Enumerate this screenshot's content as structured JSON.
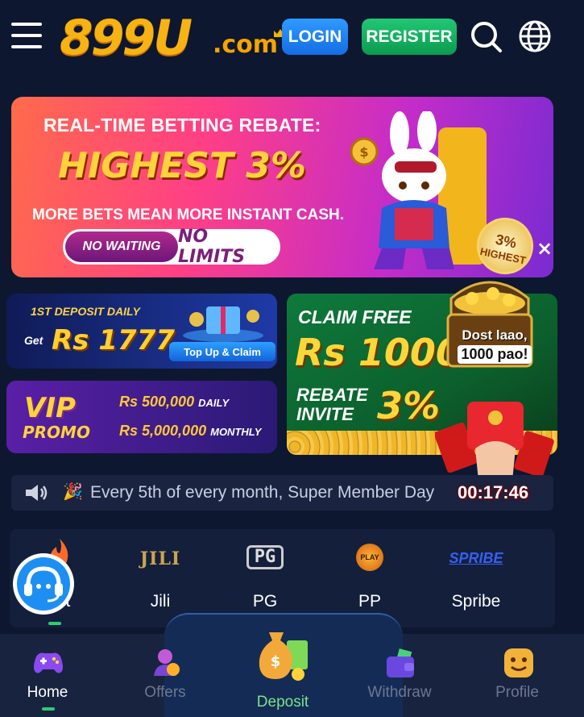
{
  "header": {
    "logo_text": "899U",
    "logo_suffix": ".com",
    "login_label": "LOGIN",
    "register_label": "REGISTER"
  },
  "banner": {
    "line1": "REAL-TIME BETTING REBATE:",
    "line2": "HIGHEST 3%",
    "line3": "MORE BETS MEAN MORE INSTANT CASH.",
    "pill_left": "NO WAITING",
    "pill_right": "NO LIMITS",
    "badge_value": "3%",
    "badge_label": "HIGHEST"
  },
  "promos": {
    "first_deposit": {
      "heading": "1ST DEPOSIT DAILY",
      "get": "Get",
      "amount": "Rs 1777",
      "button": "Top Up & Claim"
    },
    "vip": {
      "title": "VIP",
      "subtitle": "PROMO",
      "daily_amount": "Rs 500,000",
      "daily_label": "DAILY",
      "monthly_amount": "Rs 5,000,000",
      "monthly_label": "MONTHLY"
    },
    "claim": {
      "line1": "CLAIM FREE",
      "amount": "Rs 1000",
      "line3a": "REBATE",
      "line3b": "INVITE",
      "percent": "3%"
    }
  },
  "floating": {
    "line1": "Dost laao,",
    "line2": "1000 pao!",
    "timer": "00:17:46"
  },
  "marquee": {
    "text": "Every 5th of every month, Super Member Day"
  },
  "providers": [
    {
      "label": "Hot",
      "logo": ""
    },
    {
      "label": "Jili",
      "logo": "JILI"
    },
    {
      "label": "PG",
      "logo": "PG"
    },
    {
      "label": "PP",
      "logo": "PLAY"
    },
    {
      "label": "Spribe",
      "logo": "SPRIBE"
    }
  ],
  "nav": {
    "home": "Home",
    "offers": "Offers",
    "deposit": "Deposit",
    "withdraw": "Withdraw",
    "profile": "Profile"
  },
  "colors": {
    "background": "#0e1730",
    "login": "#1e86f0",
    "register": "#14ae5c",
    "active_indicator": "#2ecc71"
  }
}
